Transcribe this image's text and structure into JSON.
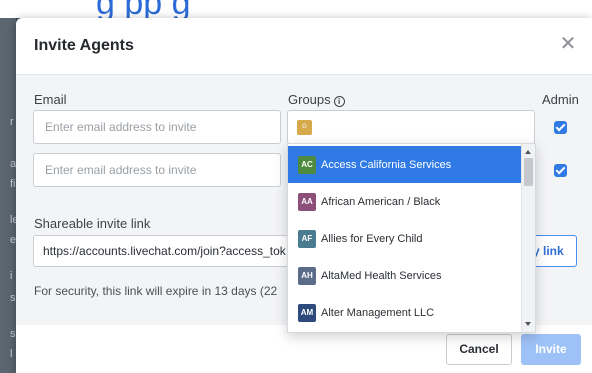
{
  "modal": {
    "title": "Invite Agents",
    "close_glyph": "✕"
  },
  "form": {
    "email_label": "Email",
    "groups_label": "Groups",
    "admin_label": "Admin",
    "email_placeholder": "Enter email address to invite",
    "group_chip_letter": "G",
    "admin_checked": [
      true,
      true
    ]
  },
  "invite_link": {
    "label": "Shareable invite link",
    "url": "https://accounts.livechat.com/join?access_tok",
    "copy_button": "y link",
    "security_text": "For security, this link will expire in 13 days (22"
  },
  "footer": {
    "cancel": "Cancel",
    "invite": "Invite"
  },
  "dropdown": {
    "items": [
      {
        "initials": "AC",
        "name": "Access California Services",
        "color": "#4e8a3e",
        "selected": true
      },
      {
        "initials": "AA",
        "name": "African American / Black",
        "color": "#8b4f7a",
        "selected": false
      },
      {
        "initials": "AF",
        "name": "Allies for Every Child",
        "color": "#4a7b91",
        "selected": false
      },
      {
        "initials": "AH",
        "name": "AltaMed Health Services",
        "color": "#5a6c8a",
        "selected": false
      },
      {
        "initials": "AM",
        "name": "Alter Management LLC",
        "color": "#2c4a7c",
        "selected": false
      }
    ]
  },
  "background": {
    "top_text": "g           pp   g",
    "side_letters": [
      "r",
      "a",
      "fi",
      "le",
      "e",
      "i",
      "s",
      "sl",
      "l"
    ]
  },
  "colors": {
    "accent": "#2f7ae5",
    "invite_disabled": "#9ec2f7"
  }
}
